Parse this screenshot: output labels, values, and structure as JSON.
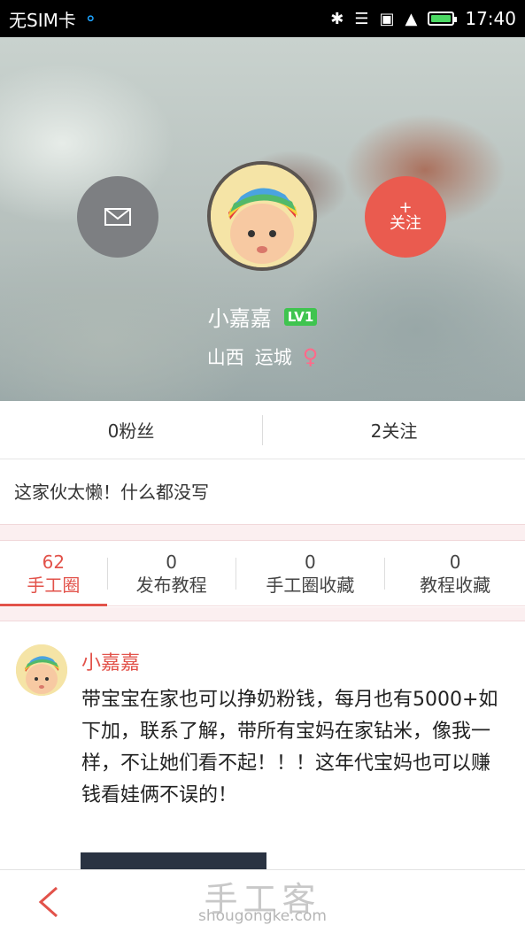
{
  "status_bar": {
    "carrier": "无SIM卡",
    "time": "17:40",
    "icons": [
      "headset-icon",
      "bluetooth-icon",
      "wifi-icon",
      "sim-error-icon",
      "signal-icon",
      "battery-icon"
    ],
    "battery_level": 0.85
  },
  "profile": {
    "username": "小嘉嘉",
    "level": "LV1",
    "province": "山西",
    "city": "运城",
    "gender_icon": "female-icon",
    "follow_plus": "+",
    "follow_label": "关注",
    "message_icon": "mail-icon"
  },
  "stats": {
    "fans": "0粉丝",
    "following": "2关注"
  },
  "bio": "这家伙太懒！什么都没写",
  "tabs": [
    {
      "count": "62",
      "label": "手工圈",
      "active": true
    },
    {
      "count": "0",
      "label": "发布教程",
      "active": false
    },
    {
      "count": "0",
      "label": "手工圈收藏",
      "active": false
    },
    {
      "count": "0",
      "label": "教程收藏",
      "active": false
    }
  ],
  "post": {
    "author": "小嘉嘉",
    "content": "带宝宝在家也可以挣奶粉钱，每月也有5000+如下加，联系了解，带所有宝妈在家钻米，像我一样，不让她们看不起！！！这年代宝妈也可以赚钱看娃俩不误的！"
  },
  "bottom_bar": {
    "back_icon": "back-chevron-icon",
    "watermark_cn": "手工客",
    "watermark_en": "shougongke.com"
  },
  "colors": {
    "accent": "#e2524a",
    "follow_button": "#ea5b4f",
    "message_button": "#7d7f82",
    "level_badge": "#3fc44f",
    "female": "#ff6a8a"
  }
}
